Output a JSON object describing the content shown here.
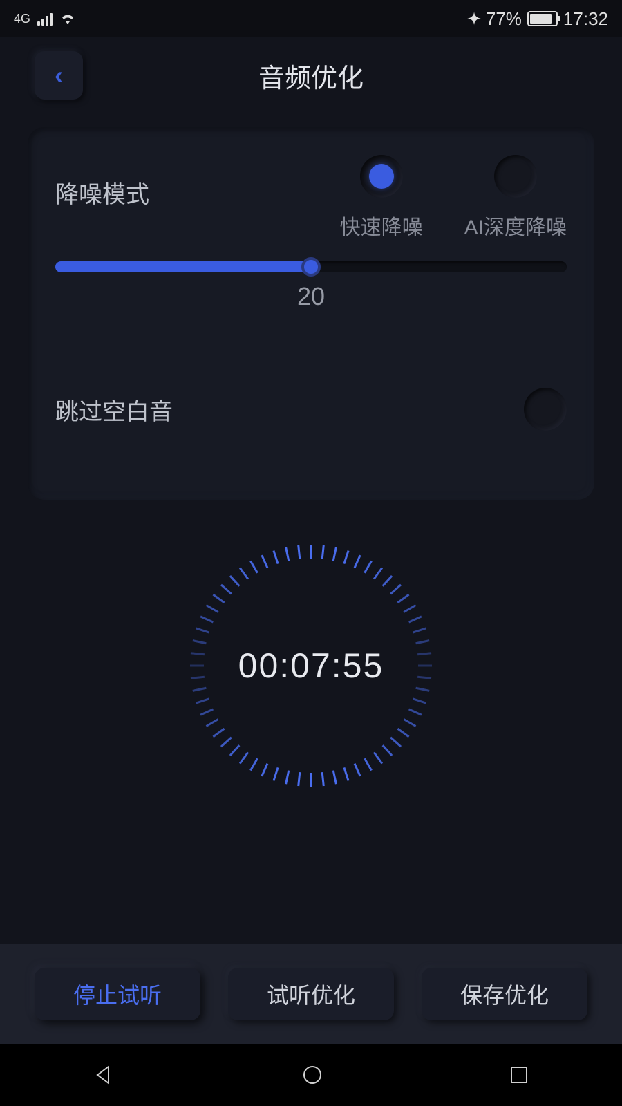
{
  "statusBar": {
    "network": "4G",
    "batteryPercent": "77%",
    "time": "17:32"
  },
  "header": {
    "title": "音频优化"
  },
  "noiseReduction": {
    "label": "降噪模式",
    "options": {
      "fast": "快速降噪",
      "aiDeep": "AI深度降噪"
    },
    "sliderValue": "20"
  },
  "skipSilence": {
    "label": "跳过空白音"
  },
  "timer": {
    "display": "00:07:55"
  },
  "buttons": {
    "stopPreview": "停止试听",
    "previewOptimize": "试听优化",
    "saveOptimize": "保存优化"
  }
}
